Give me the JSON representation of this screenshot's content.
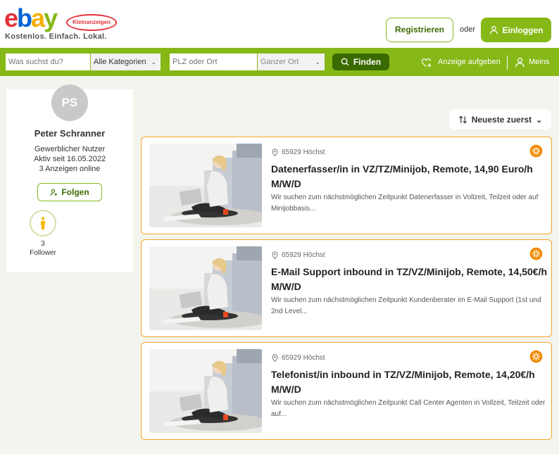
{
  "header": {
    "logo_badge": "Kleinanzeigen",
    "logo_word": "ebay",
    "tagline": "Kostenlos. Einfach. Lokal.",
    "register_label": "Registrieren",
    "or_label": "oder",
    "login_label": "Einloggen"
  },
  "search": {
    "what_placeholder": "Was suchst du?",
    "category_value": "Alle Kategorien",
    "where_placeholder": "PLZ oder Ort",
    "radius_value": "Ganzer Ort",
    "find_label": "Finden",
    "post_ad_label": "Anzeige aufgeben",
    "my_label": "Meins"
  },
  "profile": {
    "initials": "PS",
    "name": "Peter Schranner",
    "user_type": "Gewerblicher Nutzer",
    "active_since": "Aktiv seit 16.05.2022",
    "ads_online": "3 Anzeigen online",
    "follow_label": "Folgen",
    "follower_count": "3",
    "follower_label": "Follower"
  },
  "sort": {
    "label": "Neueste zuerst"
  },
  "listings": [
    {
      "location": "65929 Höchst",
      "title": "Datenerfasser/in in VZ/TZ/Minijob, Remote, 14,90 Euro/h M/W/D",
      "description": "Wir suchen zum nächstmöglichen Zeitpunkt Datenerfasser in Vollzeit, Teilzeit oder auf Minijobbasis..."
    },
    {
      "location": "65929 Höchst",
      "title": "E-Mail Support inbound in TZ/VZ/Minijob, Remote, 14,50€/h M/W/D",
      "description": "Wir suchen zum nächstmöglichen Zeitpunkt Kundenberater im E-Mail Support (1st und 2nd Level..."
    },
    {
      "location": "65929 Höchst",
      "title": "Telefonist/in inbound in TZ/VZ/Minijob, Remote, 14,20€/h M/W/D",
      "description": "Wir suchen zum nächstmöglichen Zeitpunkt Call Center Agenten in Vollzeit, Teilzeit oder auf..."
    }
  ],
  "colors": {
    "brand_green": "#86b817",
    "dark_green": "#3a6b00",
    "card_border": "#f5a623",
    "badge_orange": "#f08a00"
  }
}
